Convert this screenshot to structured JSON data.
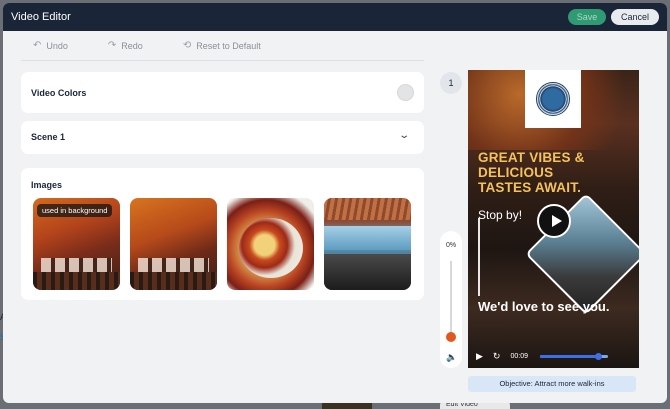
{
  "background_page": {
    "left_text_a": "A",
    "left_text_b": "S",
    "edit_tab": "Edit Video"
  },
  "modal": {
    "title": "Video Editor",
    "save_label": "Save",
    "cancel_label": "Cancel"
  },
  "toolbar": {
    "undo_label": "Undo",
    "redo_label": "Redo",
    "reset_label": "Reset to Default"
  },
  "sections": {
    "video_colors": "Video Colors",
    "scene": "Scene 1",
    "images": "Images"
  },
  "images": {
    "badge": "used in background",
    "items": [
      "restaurant-interior-1",
      "restaurant-interior-2",
      "food-dish",
      "seaside-terrace"
    ]
  },
  "preview": {
    "scene_number": "1",
    "volume_percent": "0%",
    "headline": "GREAT VIBES & DELICIOUS TASTES AWAIT.",
    "subline": "Stop by!",
    "closing": "We'd love to see you.",
    "time": "00:09",
    "progress": 0.85,
    "objective": "Objective: Attract more walk-ins"
  },
  "colors": {
    "titlebar": "#1b2538",
    "save_button": "#2f9a74",
    "headline": "#f5c25a",
    "volume_knob": "#e2571c",
    "player_progress": "#3d6fe6"
  }
}
